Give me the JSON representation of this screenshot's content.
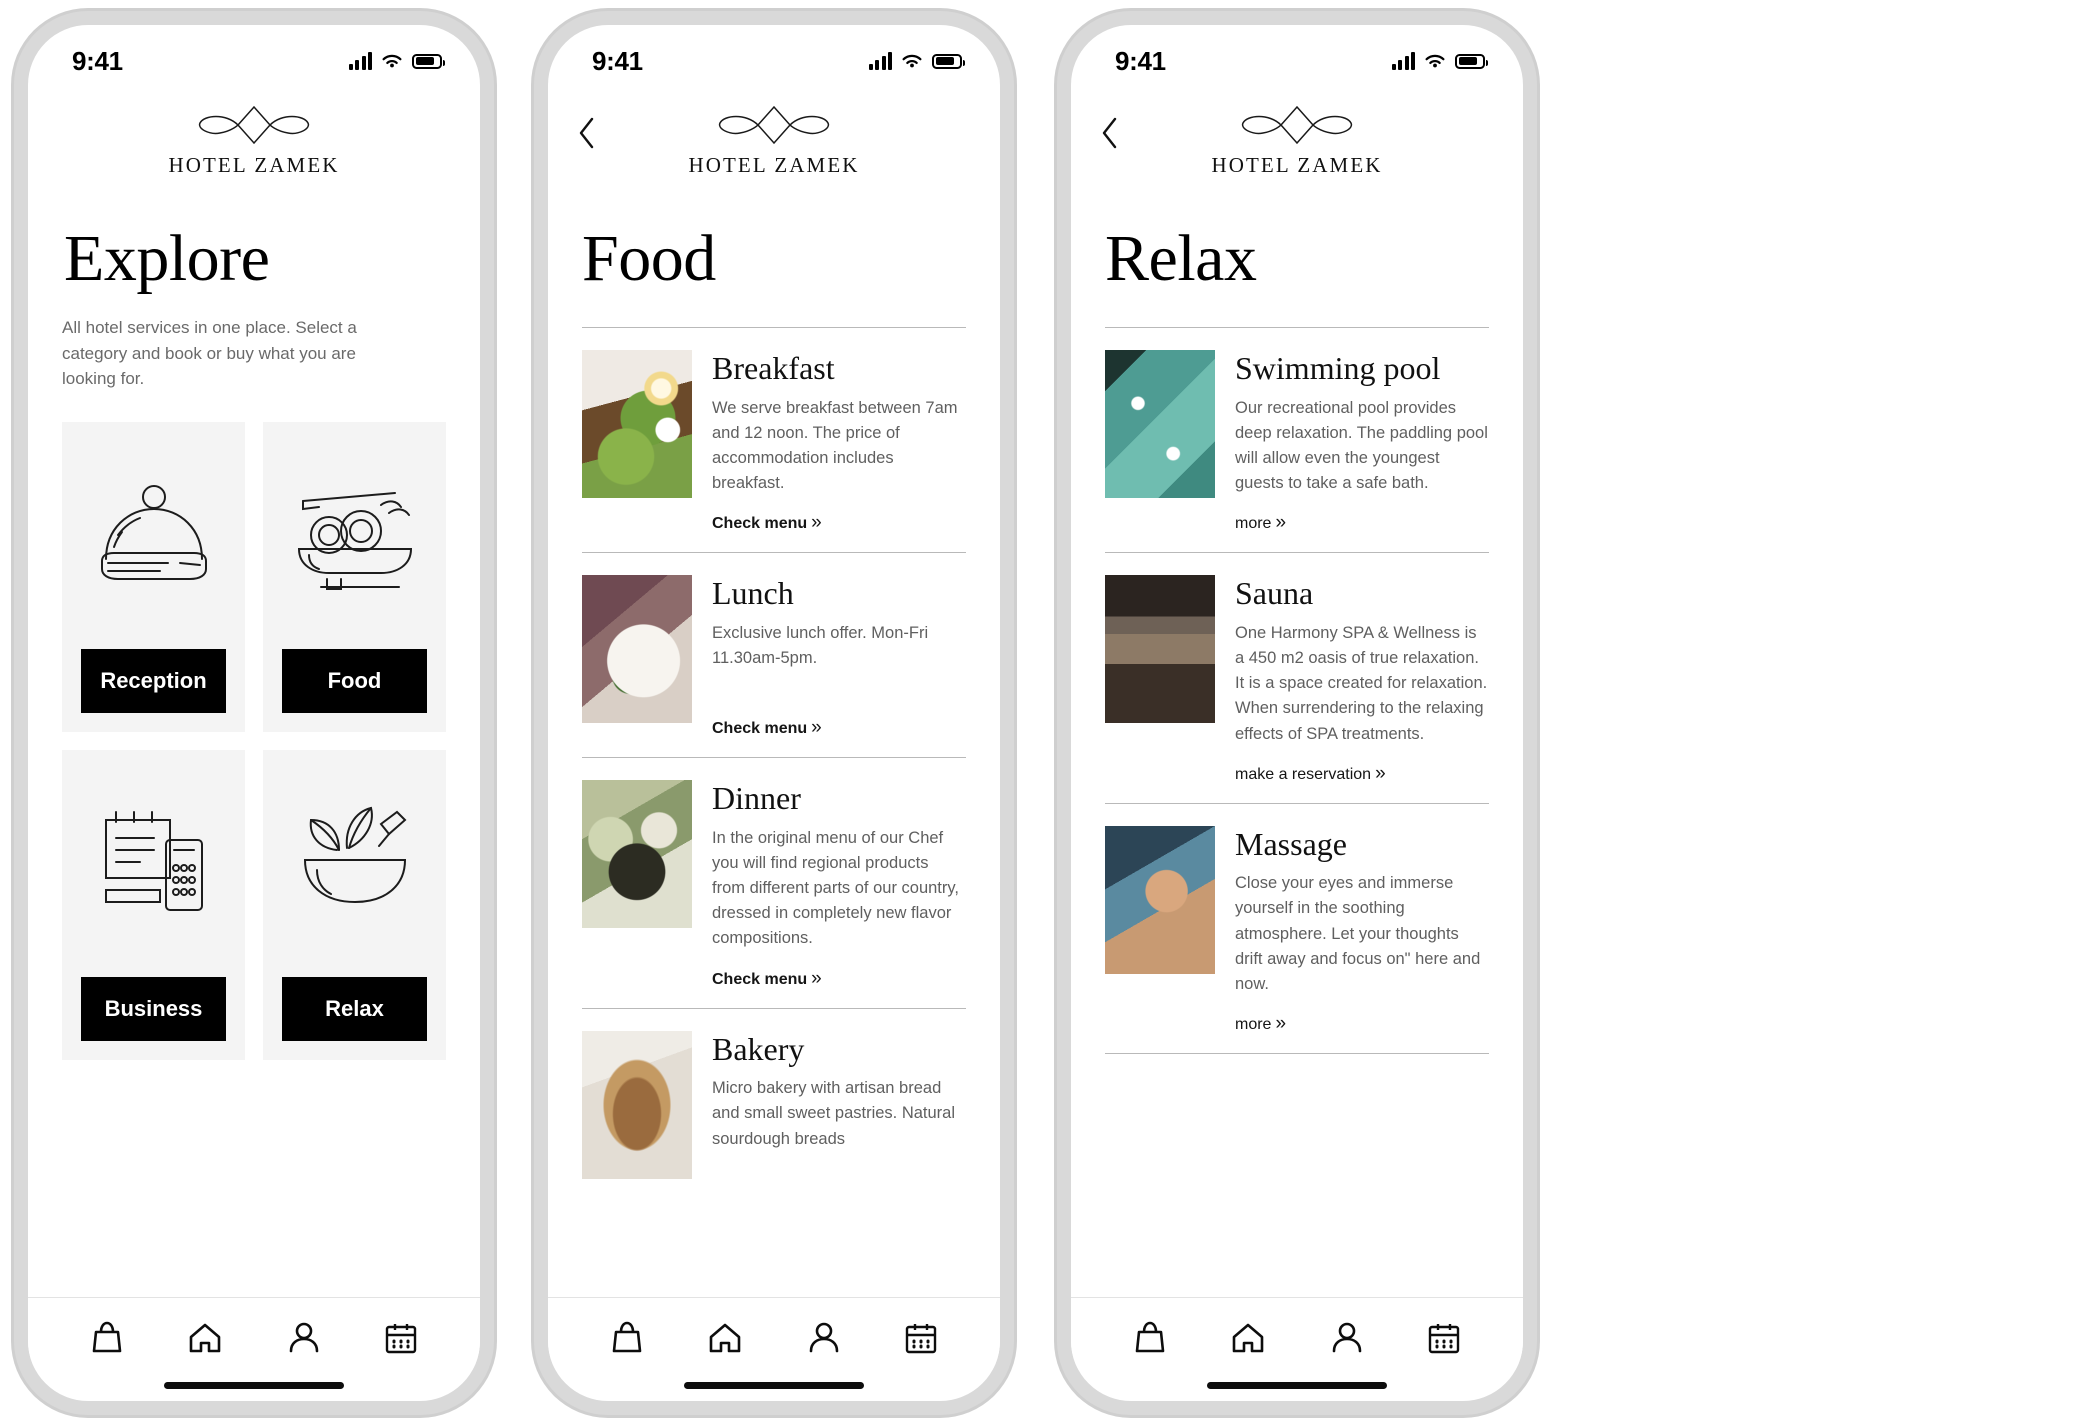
{
  "brand": {
    "name": "HOTEL ZAMEK",
    "logo_icon": "ornament-flourish-diamond-icon"
  },
  "status_bar": {
    "time": "9:41",
    "signal_icon": "cellular-bars-icon",
    "wifi_icon": "wifi-icon",
    "battery_icon": "battery-icon"
  },
  "tab_bar": {
    "items": [
      {
        "name": "shop",
        "icon": "shopping-bag-icon"
      },
      {
        "name": "home",
        "icon": "home-icon"
      },
      {
        "name": "profile",
        "icon": "person-icon"
      },
      {
        "name": "bookings",
        "icon": "calendar-icon"
      }
    ]
  },
  "screens": [
    {
      "id": "explore",
      "title": "Explore",
      "subtitle": "All hotel services in one place. Select a category and book or buy what you are looking for.",
      "has_back": false,
      "tiles": [
        {
          "label": "Reception",
          "icon": "cloche-dome-icon"
        },
        {
          "label": "Food",
          "icon": "pasta-plate-icon"
        },
        {
          "label": "Business",
          "icon": "fax-machine-icon"
        },
        {
          "label": "Relax",
          "icon": "mortar-pestle-herbs-icon"
        }
      ]
    },
    {
      "id": "food",
      "title": "Food",
      "has_back": true,
      "back_icon": "chevron-left-icon",
      "items": [
        {
          "title": "Breakfast",
          "desc": "We serve breakfast between 7am and 12 noon. The price of accommodation includes breakfast.",
          "link": "Check menu",
          "link_chevron": "»",
          "thumb": "thumb-breakfast",
          "thumb_alt": "avocado-toast-photo"
        },
        {
          "title": "Lunch",
          "desc": "Exclusive lunch offer. Mon-Fri 11.30am-5pm.",
          "link": "Check menu",
          "link_chevron": "»",
          "thumb": "thumb-lunch",
          "thumb_alt": "lunch-plate-photo"
        },
        {
          "title": "Dinner",
          "desc": "In the original menu of our Chef you will find regional products from different parts of our country, dressed in completely new flavor compositions.",
          "link": "Check menu",
          "link_chevron": "»",
          "thumb": "thumb-dinner",
          "thumb_alt": "dinner-dish-photo"
        },
        {
          "title": "Bakery",
          "desc": "Micro bakery with artisan bread and small sweet pastries. Natural sourdough breads",
          "link": "",
          "link_chevron": "",
          "thumb": "thumb-bakery",
          "thumb_alt": "sourdough-bread-photo"
        }
      ]
    },
    {
      "id": "relax",
      "title": "Relax",
      "has_back": true,
      "back_icon": "chevron-left-icon",
      "items": [
        {
          "title": "Swimming pool",
          "desc": "Our recreational pool provides deep relaxation. The paddling pool will allow even the youngest guests to take a safe bath.",
          "link": "more",
          "link_chevron": "»",
          "thumb": "thumb-pool",
          "thumb_alt": "swimming-pool-photo"
        },
        {
          "title": "Sauna",
          "desc": "One Harmony SPA & Wellness is a 450 m2 oasis of true relaxation. It is a space created for relaxation. When surrendering to the relaxing effects of SPA treatments.",
          "link": "make a reservation",
          "link_chevron": "»",
          "thumb": "thumb-sauna",
          "thumb_alt": "sauna-interior-photo"
        },
        {
          "title": "Massage",
          "desc": "Close your eyes and immerse yourself in the soothing atmosphere. Let your thoughts drift away and focus on\" here and now.",
          "link": "more",
          "link_chevron": "»",
          "thumb": "thumb-massage",
          "thumb_alt": "massage-treatment-photo"
        }
      ]
    }
  ],
  "colors": {
    "accent": "#000000",
    "tile_bg": "#f4f4f4",
    "body_text": "#5f5f5f",
    "divider": "#b9b9b9"
  }
}
